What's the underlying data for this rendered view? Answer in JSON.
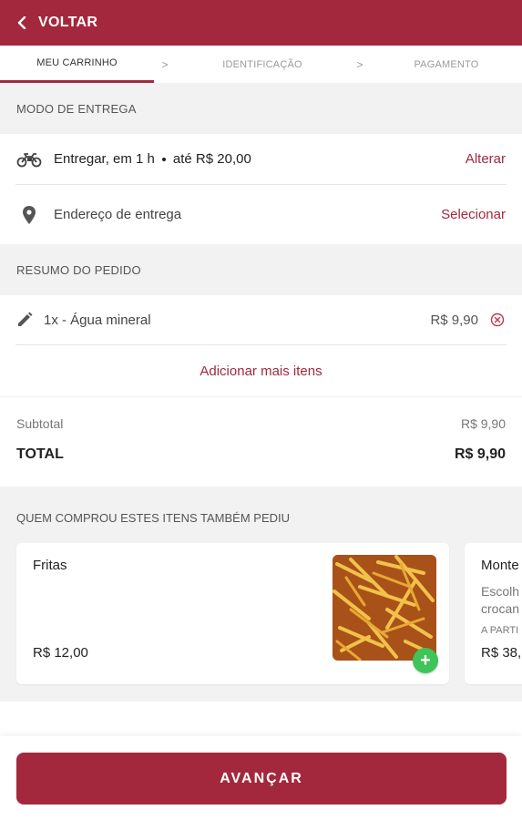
{
  "header": {
    "back_label": "VOLTAR"
  },
  "steps": [
    {
      "label": "MEU CARRINHO"
    },
    {
      "label": "IDENTIFICAÇÃO"
    },
    {
      "label": "PAGAMENTO"
    }
  ],
  "step_separator": ">",
  "delivery": {
    "section_title": "MODO DE ENTREGA",
    "mode_text": "Entregar, em 1 h",
    "mode_limit": "até R$ 20,00",
    "change_label": "Alterar",
    "address_label": "Endereço de entrega",
    "select_label": "Selecionar"
  },
  "order": {
    "section_title": "RESUMO DO PEDIDO",
    "items": [
      {
        "description": "1x - Água mineral",
        "price": "R$ 9,90"
      }
    ],
    "add_more_label": "Adicionar mais itens"
  },
  "totals": {
    "subtotal_label": "Subtotal",
    "subtotal_value": "R$ 9,90",
    "total_label": "TOTAL",
    "total_value": "R$ 9,90"
  },
  "recommendations": {
    "section_title": "QUEM COMPROU ESTES ITENS TAMBÉM PEDIU",
    "cards": [
      {
        "name": "Fritas",
        "price": "R$ 12,00",
        "add_symbol": "+"
      },
      {
        "name": "Monte",
        "description_line1": "Escolh",
        "description_line2": "crocan",
        "price_prefix": "A PARTI",
        "price": "R$ 38,"
      }
    ]
  },
  "footer": {
    "advance_label": "AVANÇAR"
  },
  "colors": {
    "brand": "#a4283d",
    "add_button": "#3ec457"
  }
}
